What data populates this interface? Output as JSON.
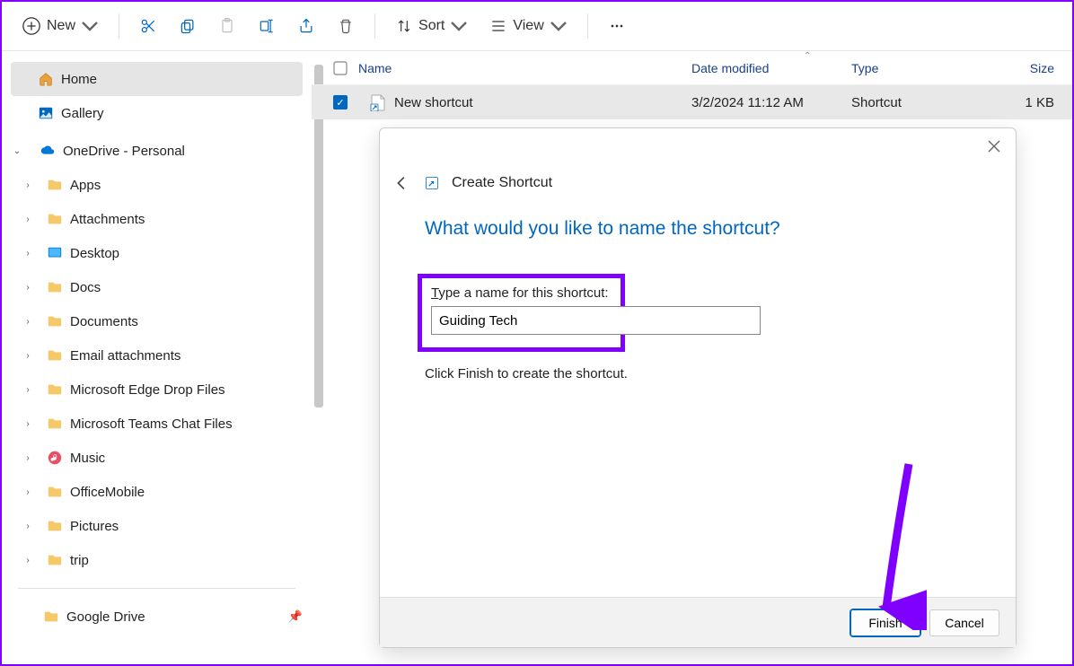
{
  "toolbar": {
    "new": "New",
    "sort": "Sort",
    "view": "View"
  },
  "sidebar": {
    "home": "Home",
    "gallery": "Gallery",
    "onedrive": "OneDrive - Personal",
    "folders": [
      "Apps",
      "Attachments",
      "Desktop",
      "Docs",
      "Documents",
      "Email attachments",
      "Microsoft Edge Drop Files",
      "Microsoft Teams Chat Files",
      "Music",
      "OfficeMobile",
      "Pictures",
      "trip"
    ],
    "gdrive": "Google Drive"
  },
  "columns": {
    "name": "Name",
    "date": "Date modified",
    "type": "Type",
    "size": "Size"
  },
  "row": {
    "name": "New shortcut",
    "date": "3/2/2024 11:12 AM",
    "type": "Shortcut",
    "size": "1 KB"
  },
  "dialog": {
    "title": "Create Shortcut",
    "question": "What would you like to name the shortcut?",
    "label": "Type a name for this shortcut:",
    "value": "Guiding Tech",
    "hint": "Click Finish to create the shortcut.",
    "finish": "Finish",
    "cancel": "Cancel"
  }
}
